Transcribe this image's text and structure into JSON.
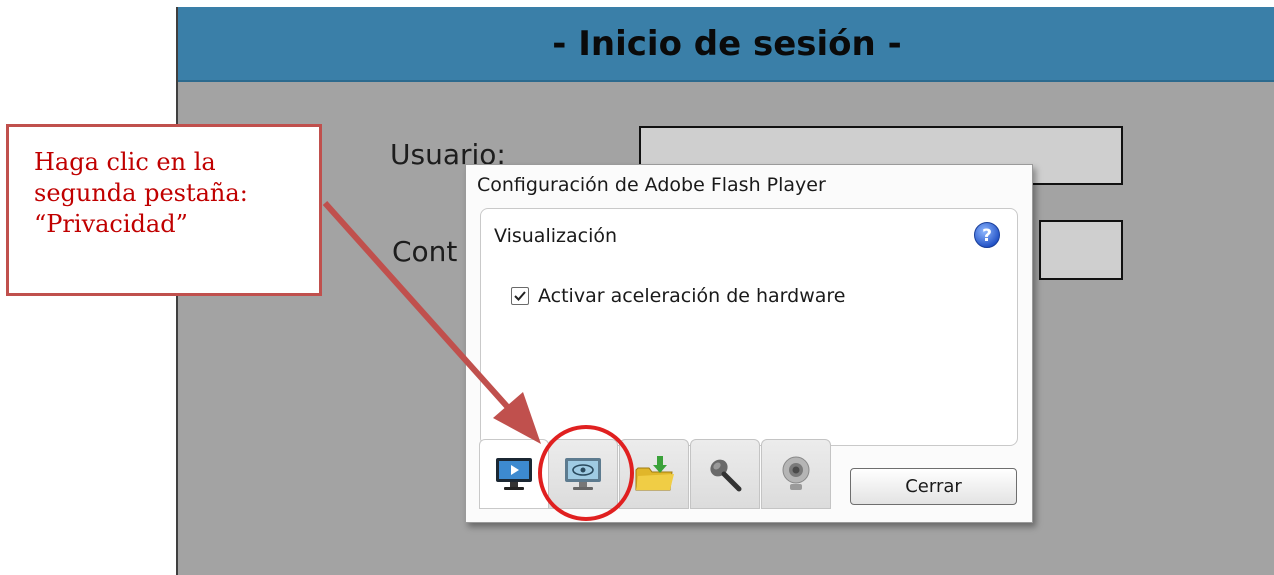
{
  "login": {
    "title": "- Inicio de sesión -",
    "user_label": "Usuario:",
    "password_label": "Cont"
  },
  "callout": {
    "line1": "Haga clic en la",
    "line2": "segunda pestaña:",
    "line3": "“Privacidad”"
  },
  "flash_dialog": {
    "title": "Configuración de Adobe Flash Player",
    "section_title": "Visualización",
    "checkbox_label": "Activar aceleración de hardware",
    "checkbox_checked": true,
    "tabs": [
      {
        "icon": "display-monitor-icon"
      },
      {
        "icon": "privacy-eye-monitor-icon"
      },
      {
        "icon": "storage-folder-icon"
      },
      {
        "icon": "microphone-icon"
      },
      {
        "icon": "webcam-icon"
      }
    ],
    "close_label": "Cerrar"
  },
  "colors": {
    "header_blue": "#3a7fa8",
    "callout_text": "#c00000",
    "callout_border": "#c0504d",
    "highlight_circle": "#e02020"
  }
}
